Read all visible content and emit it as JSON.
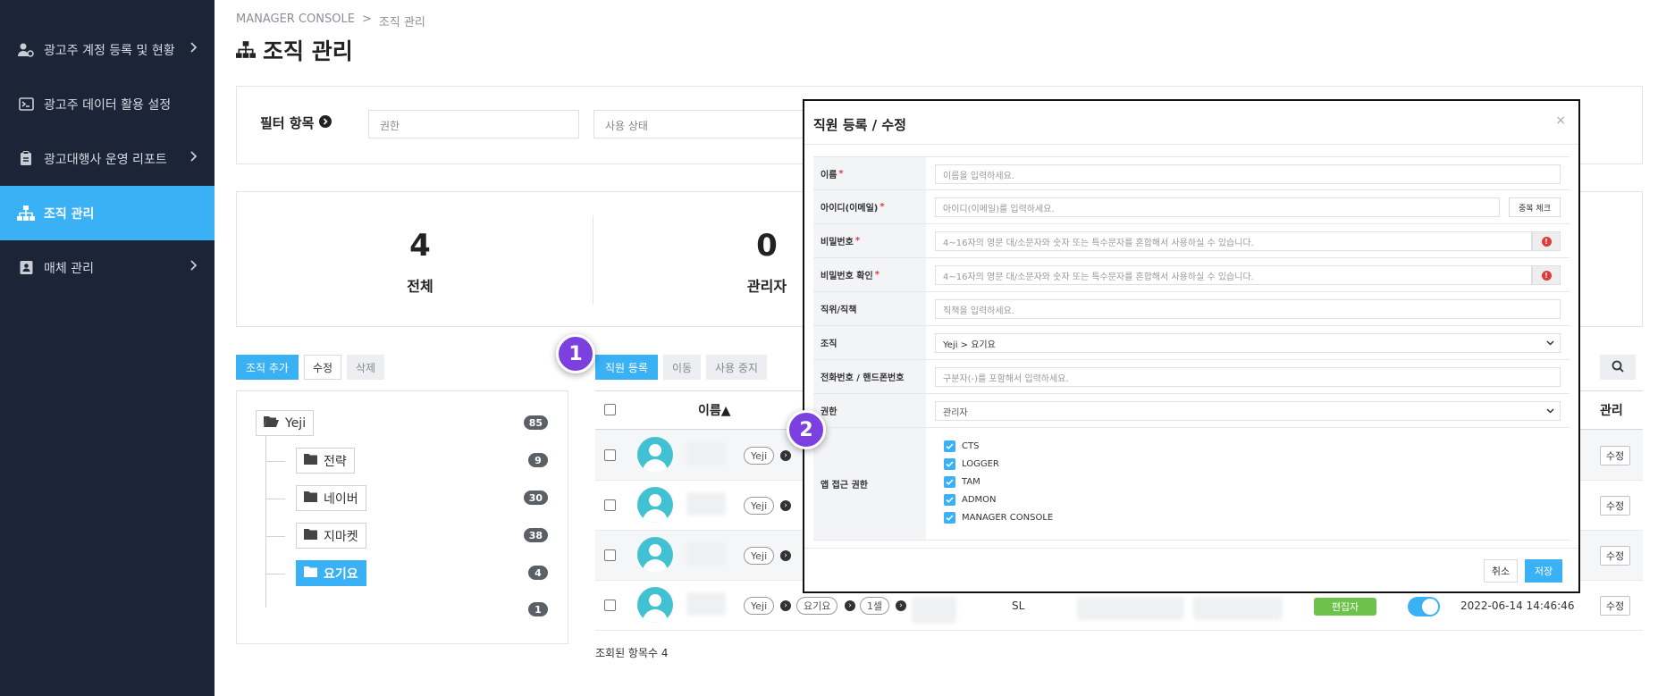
{
  "sidebar": {
    "items": [
      {
        "label": "광고주 계정 등록 및 현황",
        "icon": "user-gear-icon",
        "has_chevron": true
      },
      {
        "label": "광고주 데이터 활용 설정",
        "icon": "terminal-icon",
        "has_chevron": false
      },
      {
        "label": "광고대행사 운영 리포트",
        "icon": "clipboard-icon",
        "has_chevron": true
      },
      {
        "label": "조직 관리",
        "icon": "org-chart-icon",
        "has_chevron": false,
        "active": true
      },
      {
        "label": "매체 관리",
        "icon": "contact-card-icon",
        "has_chevron": true
      }
    ]
  },
  "breadcrumb": {
    "root": "MANAGER CONSOLE",
    "sep": ">",
    "current": "조직 관리"
  },
  "page": {
    "title": "조직 관리"
  },
  "filter": {
    "label": "필터 항목",
    "permission_placeholder": "권한",
    "status_placeholder": "사용 상태"
  },
  "stats": [
    {
      "value": "4",
      "label": "전체"
    },
    {
      "value": "0",
      "label": "관리자"
    }
  ],
  "org_toolbar": {
    "add": "조직 추가",
    "edit": "수정",
    "delete": "삭제"
  },
  "staff_toolbar": {
    "register": "직원 등록",
    "move": "이동",
    "suspend": "사용 중지"
  },
  "tree": {
    "root": {
      "label": "Yeji",
      "count": "85"
    },
    "children": [
      {
        "label": "전략",
        "count": "9"
      },
      {
        "label": "네이버",
        "count": "30"
      },
      {
        "label": "지마켓",
        "count": "38"
      },
      {
        "label": "요기요",
        "count": "4",
        "selected": true
      }
    ],
    "extra_count": "1"
  },
  "table": {
    "headers": {
      "name": "이름▲",
      "manage": "관리"
    },
    "rows": [
      {
        "org": "Yeji",
        "edit": "수정"
      },
      {
        "org": "Yeji",
        "edit": "수정"
      },
      {
        "org": "Yeji",
        "edit": "수정"
      },
      {
        "org": "Yeji",
        "org2": "요기요",
        "org3": "1셀",
        "position": "SL",
        "role": "편집자",
        "active": true,
        "datetime": "2022-06-14 14:46:46",
        "edit": "수정"
      }
    ],
    "result_count": "조회된 항목수 4"
  },
  "modal": {
    "title": "직원 등록 / 수정",
    "close": "×",
    "fields": {
      "name": {
        "label": "이름",
        "placeholder": "이름을 입력하세요."
      },
      "id": {
        "label": "아이디(이메일)",
        "placeholder": "아이디(이메일)를 입력하세요.",
        "button": "중복 체크"
      },
      "password": {
        "label": "비밀번호",
        "placeholder": "4~16자의 영문 대/소문자와 숫자 또는 특수문자를 혼합해서 사용하실 수 있습니다."
      },
      "password_confirm": {
        "label": "비밀번호 확인",
        "placeholder": "4~16자의 영문 대/소문자와 숫자 또는 특수문자를 혼합해서 사용하실 수 있습니다."
      },
      "position": {
        "label": "직위/직책",
        "placeholder": "직책을 입력하세요."
      },
      "org": {
        "label": "조직",
        "value": "Yeji > 요기요"
      },
      "phone": {
        "label": "전화번호 / 핸드폰번호",
        "placeholder": "구분자(-)를 포함해서 입력하세요."
      },
      "role": {
        "label": "권한",
        "value": "관리자"
      },
      "app_access": {
        "label": "앱 접근 권한",
        "options": [
          "CTS",
          "LOGGER",
          "TAM",
          "ADMON",
          "MANAGER CONSOLE"
        ]
      }
    },
    "cancel": "취소",
    "save": "저장"
  },
  "steps": [
    "1",
    "2"
  ],
  "colors": {
    "sidebar_bg": "#1c2538",
    "accent": "#3ab0f5",
    "step": "#7c3fe0",
    "role_badge": "#6cc24a",
    "error": "#e03b3b"
  }
}
